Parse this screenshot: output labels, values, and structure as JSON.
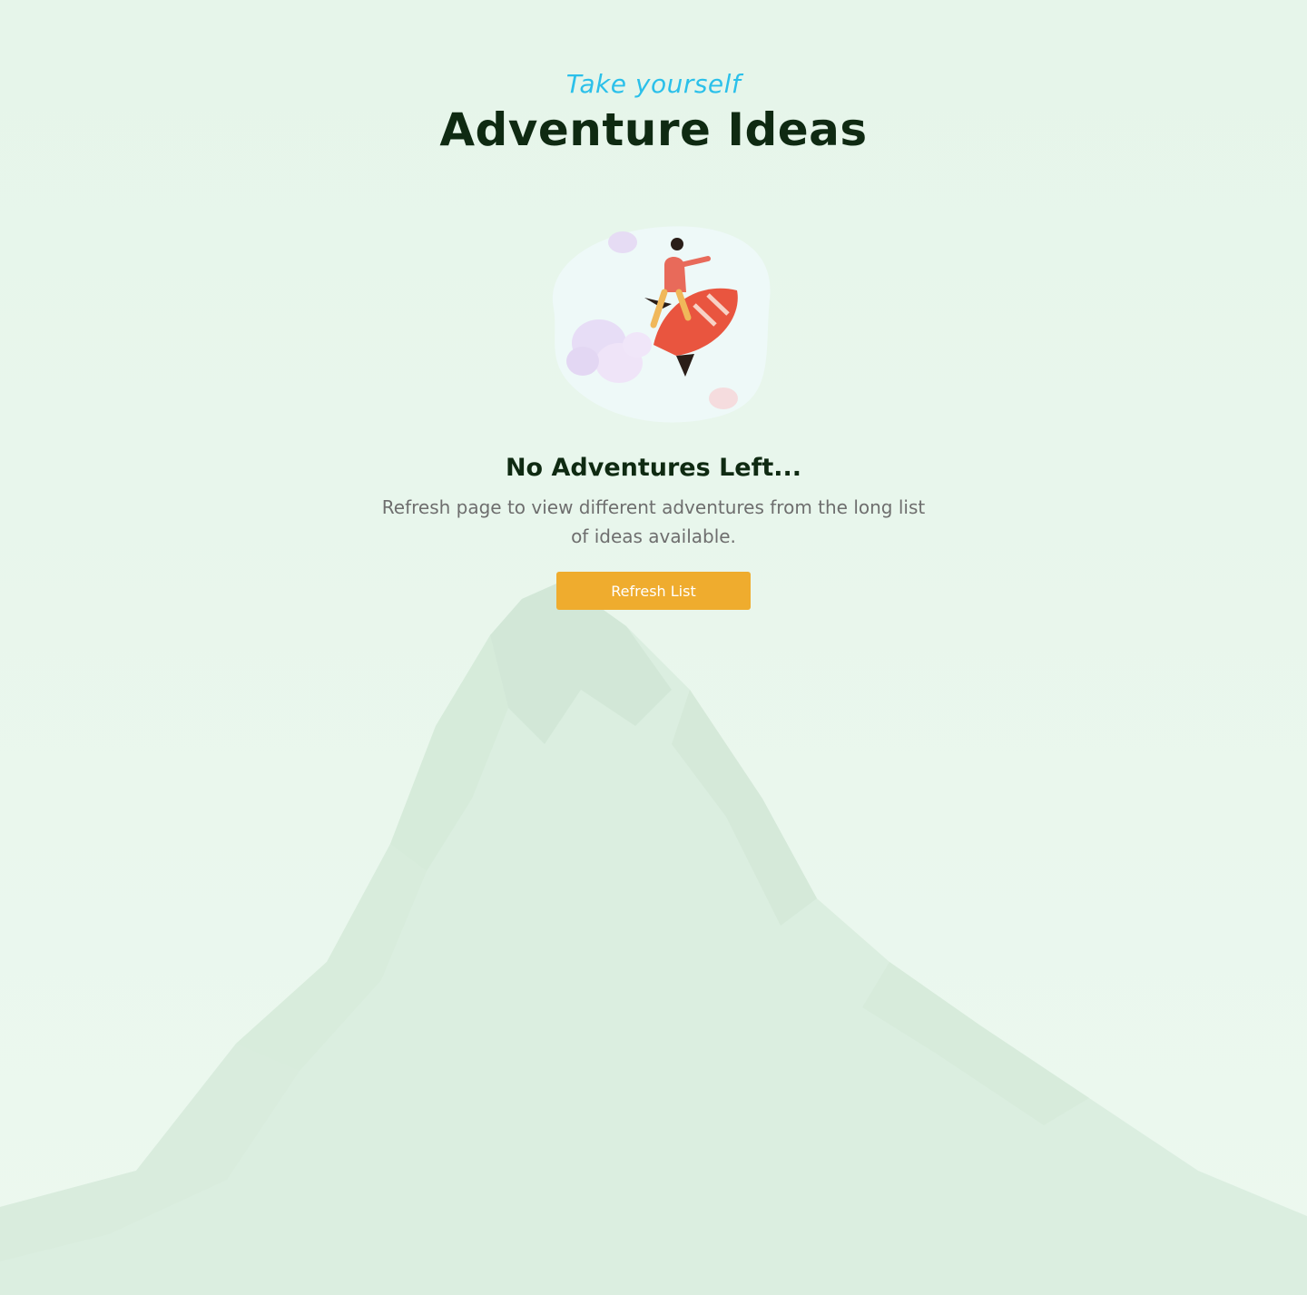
{
  "header": {
    "eyebrow": "Take yourself",
    "title": "Adventure Ideas"
  },
  "empty_state": {
    "heading": "No Adventures Left...",
    "description": "Refresh page to view different adventures from the long list of ideas available.",
    "button_label": "Refresh List"
  },
  "colors": {
    "background": "#e8f6ec",
    "eyebrow": "#2bc0ea",
    "title": "#0f2a12",
    "description": "#6e6e6e",
    "button": "#efac2e"
  }
}
